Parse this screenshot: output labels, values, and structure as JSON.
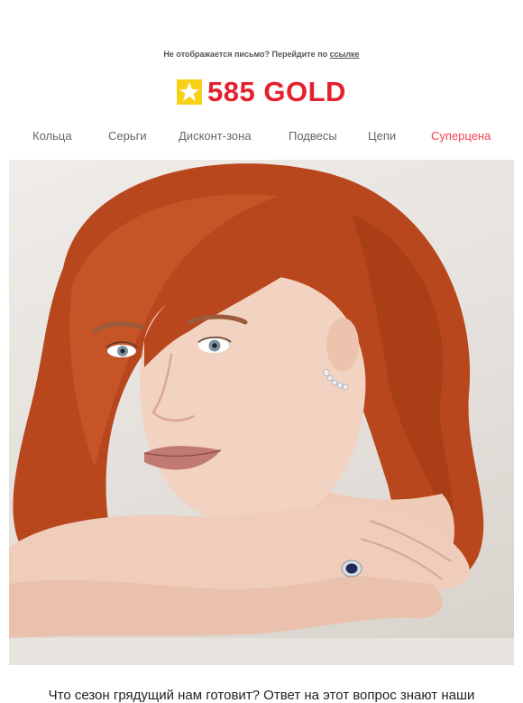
{
  "preheader": {
    "text": "Не отображается письмо? Перейдите по",
    "link_label": "ссылке"
  },
  "logo": {
    "text": "585 GOLD",
    "icon": "star-logo-icon",
    "brand_color": "#e5202e",
    "mark_color": "#f7d117"
  },
  "nav": {
    "items": [
      {
        "label": "Кольца"
      },
      {
        "label": "Серьги"
      },
      {
        "label": "Дисконт-зона"
      },
      {
        "label": "Подвесы"
      },
      {
        "label": "Цепи"
      },
      {
        "label": "Суперцена",
        "accent": "#f0424e"
      }
    ]
  },
  "hero": {
    "image": "hero-photo"
  },
  "intro": {
    "text": "Что сезон грядущий нам готовит? Ответ на этот вопрос знают наши"
  }
}
